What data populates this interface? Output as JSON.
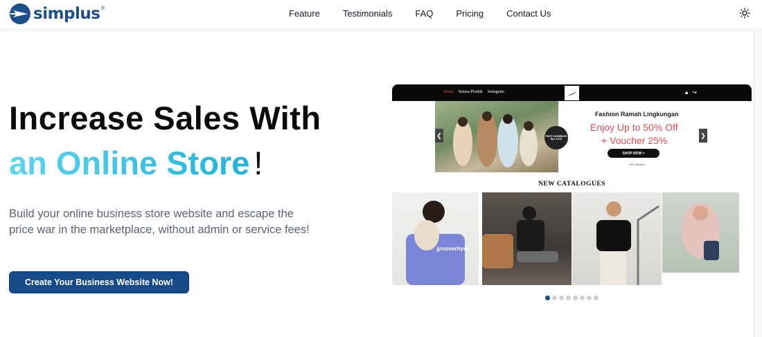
{
  "brand": {
    "name": "simplus",
    "mark": "®",
    "color": "#1d4f8c"
  },
  "nav": {
    "items": [
      "Feature",
      "Testimonials",
      "FAQ",
      "Pricing",
      "Contact Us"
    ]
  },
  "theme_toggle_icon": "sun-icon",
  "hero": {
    "line1": "Increase Sales With",
    "line2_accent": "an Online Store",
    "line2_suffix": "!",
    "description": "Build your online business store website and escape the price war in the marketplace, without admin or service fees!",
    "cta_label": "Create Your Business Website Now!",
    "cta_color": "#174c8a",
    "accent_gradient": [
      "#5fd4f0",
      "#1fb3dc"
    ]
  },
  "preview": {
    "store_nav": [
      "Home",
      "Semua Produk",
      "Instagram"
    ],
    "store_icons": [
      "lock-icon",
      "login-icon"
    ],
    "banner": {
      "title": "Fashion Ramah Lingkungan",
      "line1": "Enjoy Up to 50% Off",
      "line2": "+ Voucher 25%",
      "button": "SHOP NOW >",
      "terms": "S&K Berlaku",
      "badge": "PASTI CASHBACK Rp1 JUTA",
      "accent": "#e14b53"
    },
    "catalog_title": "NEW CATALOGUES",
    "photo_captions": [
      "grooverhym."
    ]
  },
  "carousel": {
    "count": 8,
    "active": 0
  }
}
